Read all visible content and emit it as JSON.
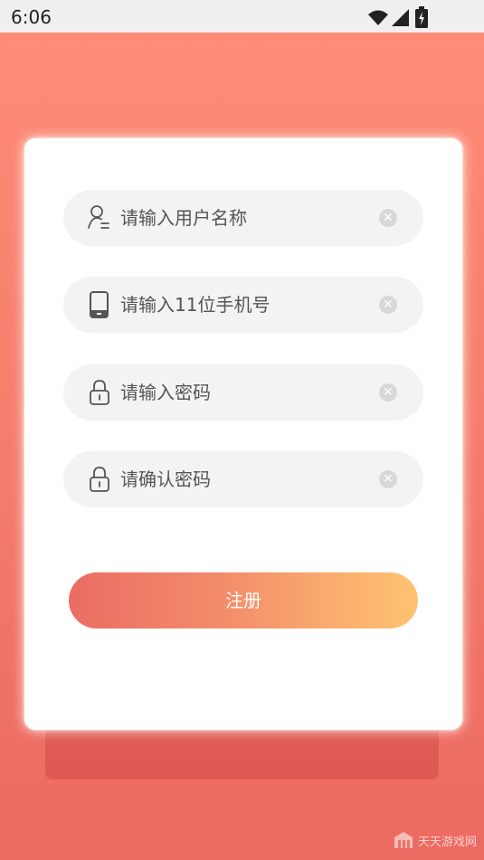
{
  "status_bar": {
    "time": "6:06",
    "icons": [
      "wifi-icon",
      "signal-icon",
      "battery-charging-icon"
    ]
  },
  "form": {
    "fields": [
      {
        "placeholder": "请输入用户名称",
        "value": "",
        "icon": "user-icon"
      },
      {
        "placeholder": "请输入11位手机号",
        "value": "",
        "icon": "phone-icon"
      },
      {
        "placeholder": "请输入密码",
        "value": "",
        "icon": "lock-icon"
      },
      {
        "placeholder": "请确认密码",
        "value": "",
        "icon": "lock-icon"
      }
    ],
    "submit_label": "注册"
  },
  "watermark": {
    "text": "天天游戏网"
  },
  "colors": {
    "background_top": "#ff8d78",
    "background_bottom": "#ec6a61",
    "button_start": "#ea6d63",
    "button_end": "#ffc471"
  }
}
